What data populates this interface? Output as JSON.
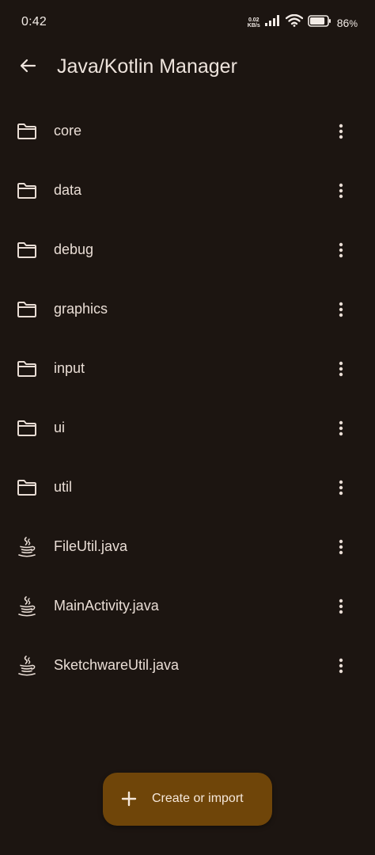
{
  "status_bar": {
    "time": "0:42",
    "net_speed_value": "0.02",
    "net_speed_unit": "KB/s",
    "battery_percent": "86",
    "battery_symbol": "%",
    "battery_level": 0.86
  },
  "app_bar": {
    "back_icon": "arrow-back-icon",
    "title": "Java/Kotlin Manager"
  },
  "items": [
    {
      "name": "core",
      "type": "folder"
    },
    {
      "name": "data",
      "type": "folder"
    },
    {
      "name": "debug",
      "type": "folder"
    },
    {
      "name": "graphics",
      "type": "folder"
    },
    {
      "name": "input",
      "type": "folder"
    },
    {
      "name": "ui",
      "type": "folder"
    },
    {
      "name": "util",
      "type": "folder"
    },
    {
      "name": "FileUtil.java",
      "type": "java"
    },
    {
      "name": "MainActivity.java",
      "type": "java"
    },
    {
      "name": "SketchwareUtil.java",
      "type": "java"
    }
  ],
  "fab": {
    "label": "Create or import",
    "icon": "plus-icon"
  },
  "colors": {
    "background": "#1c1511",
    "fab": "#6f4509",
    "text": "#e9ddd5"
  }
}
